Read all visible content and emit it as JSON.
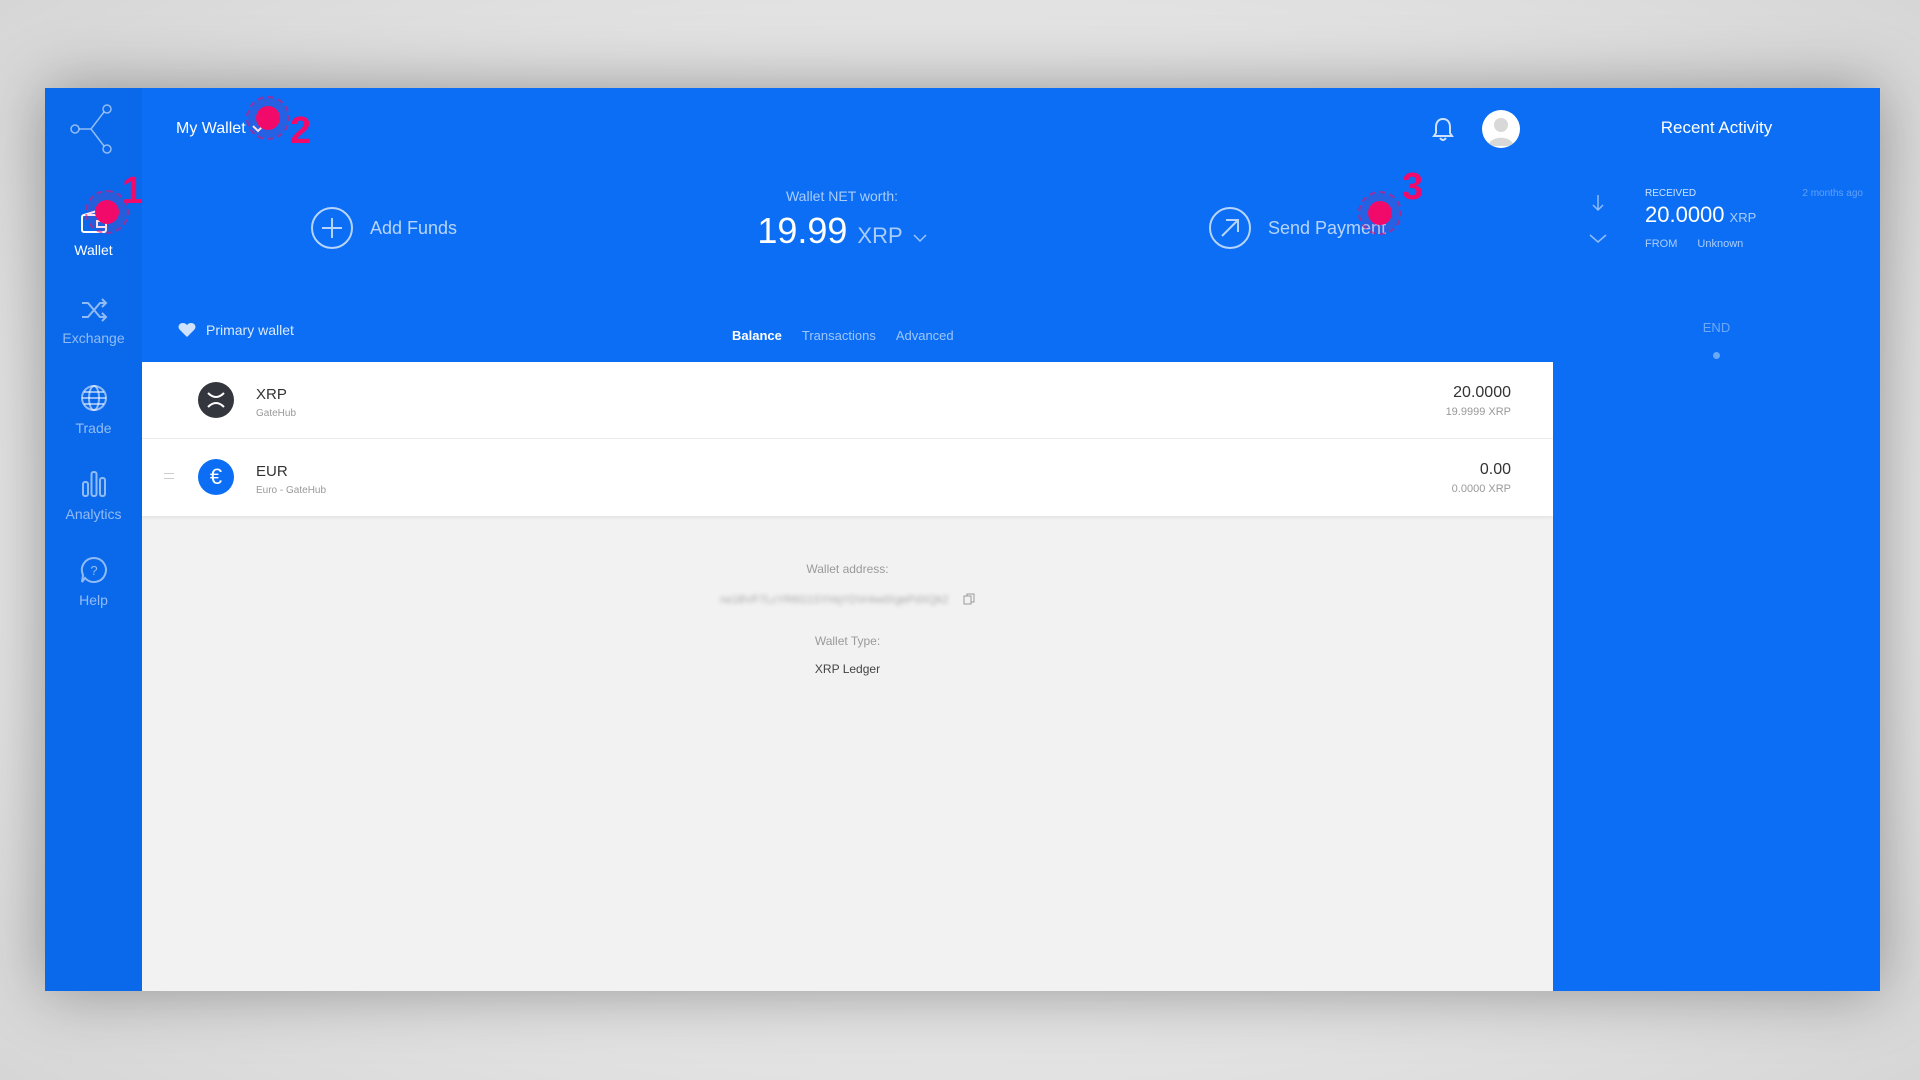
{
  "sidebar": {
    "items": [
      {
        "label": "Wallet",
        "icon": "wallet-icon",
        "active": true
      },
      {
        "label": "Exchange",
        "icon": "shuffle-icon"
      },
      {
        "label": "Trade",
        "icon": "globe-icon"
      },
      {
        "label": "Analytics",
        "icon": "bar-chart-icon"
      },
      {
        "label": "Help",
        "icon": "help-icon"
      }
    ]
  },
  "header": {
    "wallet_name": "My Wallet",
    "add_funds": "Add Funds",
    "send_payment": "Send Payment",
    "networth_label": "Wallet NET worth:",
    "networth_value": "19.99",
    "networth_unit": "XRP",
    "primary_wallet": "Primary wallet",
    "tabs": [
      "Balance",
      "Transactions",
      "Advanced"
    ],
    "active_tab": "Balance"
  },
  "assets": [
    {
      "name": "XRP",
      "issuer": "GateHub",
      "amount": "20.0000",
      "equivalent": "19.9999 XRP",
      "color": "#33363d"
    },
    {
      "name": "EUR",
      "issuer": "Euro - GateHub",
      "amount": "0.00",
      "equivalent": "0.0000 XRP",
      "color": "#0b6ef4"
    }
  ],
  "wallet_info": {
    "address_label": "Wallet address:",
    "address_value": "rw1BVF7LcYR6G1SYHqYDVr4wdXgePdXQk2",
    "type_label": "Wallet Type:",
    "type_value": "XRP Ledger"
  },
  "recent_activity": {
    "title": "Recent Activity",
    "items": [
      {
        "type": "RECEIVED",
        "time": "2 months ago",
        "amount": "20.0000",
        "unit": "XRP",
        "from_label": "FROM",
        "from_value": "Unknown"
      }
    ],
    "end_label": "END"
  },
  "annotations": [
    "1",
    "2",
    "3"
  ],
  "colors": {
    "brand": "#0b6ef4",
    "marker": "#f20a6b"
  }
}
